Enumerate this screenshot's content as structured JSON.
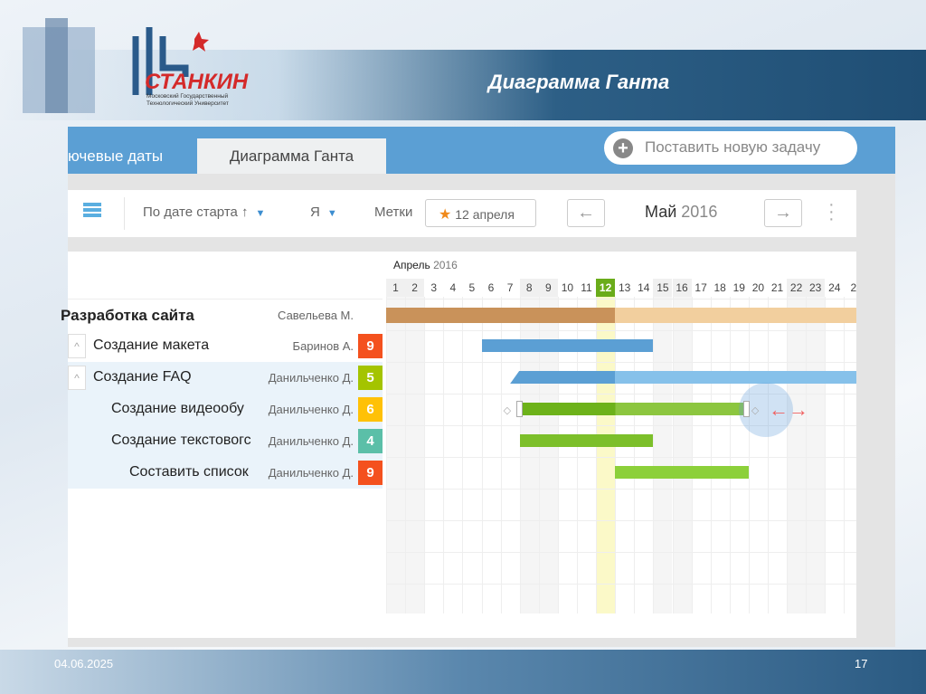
{
  "slide": {
    "title": "Диаграмма Ганта",
    "date": "04.06.2025",
    "page": "17",
    "logo": {
      "name": "СТАНКИН",
      "subtitle": "Московский Государственный Технологический Университет"
    }
  },
  "tabs": [
    {
      "label": "ючевые даты",
      "active": false
    },
    {
      "label": "Диаграмма Ганта",
      "active": true
    }
  ],
  "new_task_label": "Поставить новую задачу",
  "toolbar": {
    "sort": "По дате старта ↑",
    "me": "Я",
    "tags": "Метки",
    "tag_value": "12 апреля",
    "month": "Май",
    "year": "2016"
  },
  "gantt": {
    "month_label": "Апрель",
    "year_label": "2016",
    "today": 12,
    "days": [
      "1",
      "2",
      "3",
      "4",
      "5",
      "6",
      "7",
      "8",
      "9",
      "10",
      "11",
      "12",
      "13",
      "14",
      "15",
      "16",
      "17",
      "18",
      "19",
      "20",
      "21",
      "22",
      "23",
      "24",
      "2"
    ],
    "project": {
      "name": "Разработка сайта",
      "assignee": "Савельева М.",
      "start": 1,
      "end": 25,
      "progress_until": 12
    },
    "tasks": [
      {
        "name": "Создание макета",
        "assignee": "Баринов А.",
        "badge": "9",
        "badge_color": "#f4511e",
        "level": 1,
        "start": 6,
        "end": 14,
        "color": "#5b9fd4",
        "collapsible": true
      },
      {
        "name": "Создание FAQ",
        "assignee": "Данильченко Д.",
        "badge": "5",
        "badge_color": "#a4c400",
        "level": 1,
        "start": 7.5,
        "end": 25,
        "color": "#86c1ea",
        "collapsible": true
      },
      {
        "name": "Создание видеообу",
        "assignee": "Данильченко Д.",
        "badge": "6",
        "badge_color": "#ffc107",
        "level": 2,
        "start": 8,
        "end": 19,
        "color": "#8cc63f"
      },
      {
        "name": "Создание текстовогс",
        "assignee": "Данильченко Д.",
        "badge": "4",
        "badge_color": "#5bbfa8",
        "level": 2,
        "start": 8,
        "end": 14,
        "color": "#7cbf2a"
      },
      {
        "name": "Составить список",
        "assignee": "Данильченко Д.",
        "badge": "9",
        "badge_color": "#f4511e",
        "level": 3,
        "start": 13,
        "end": 19,
        "color": "#8cd03a"
      }
    ]
  }
}
